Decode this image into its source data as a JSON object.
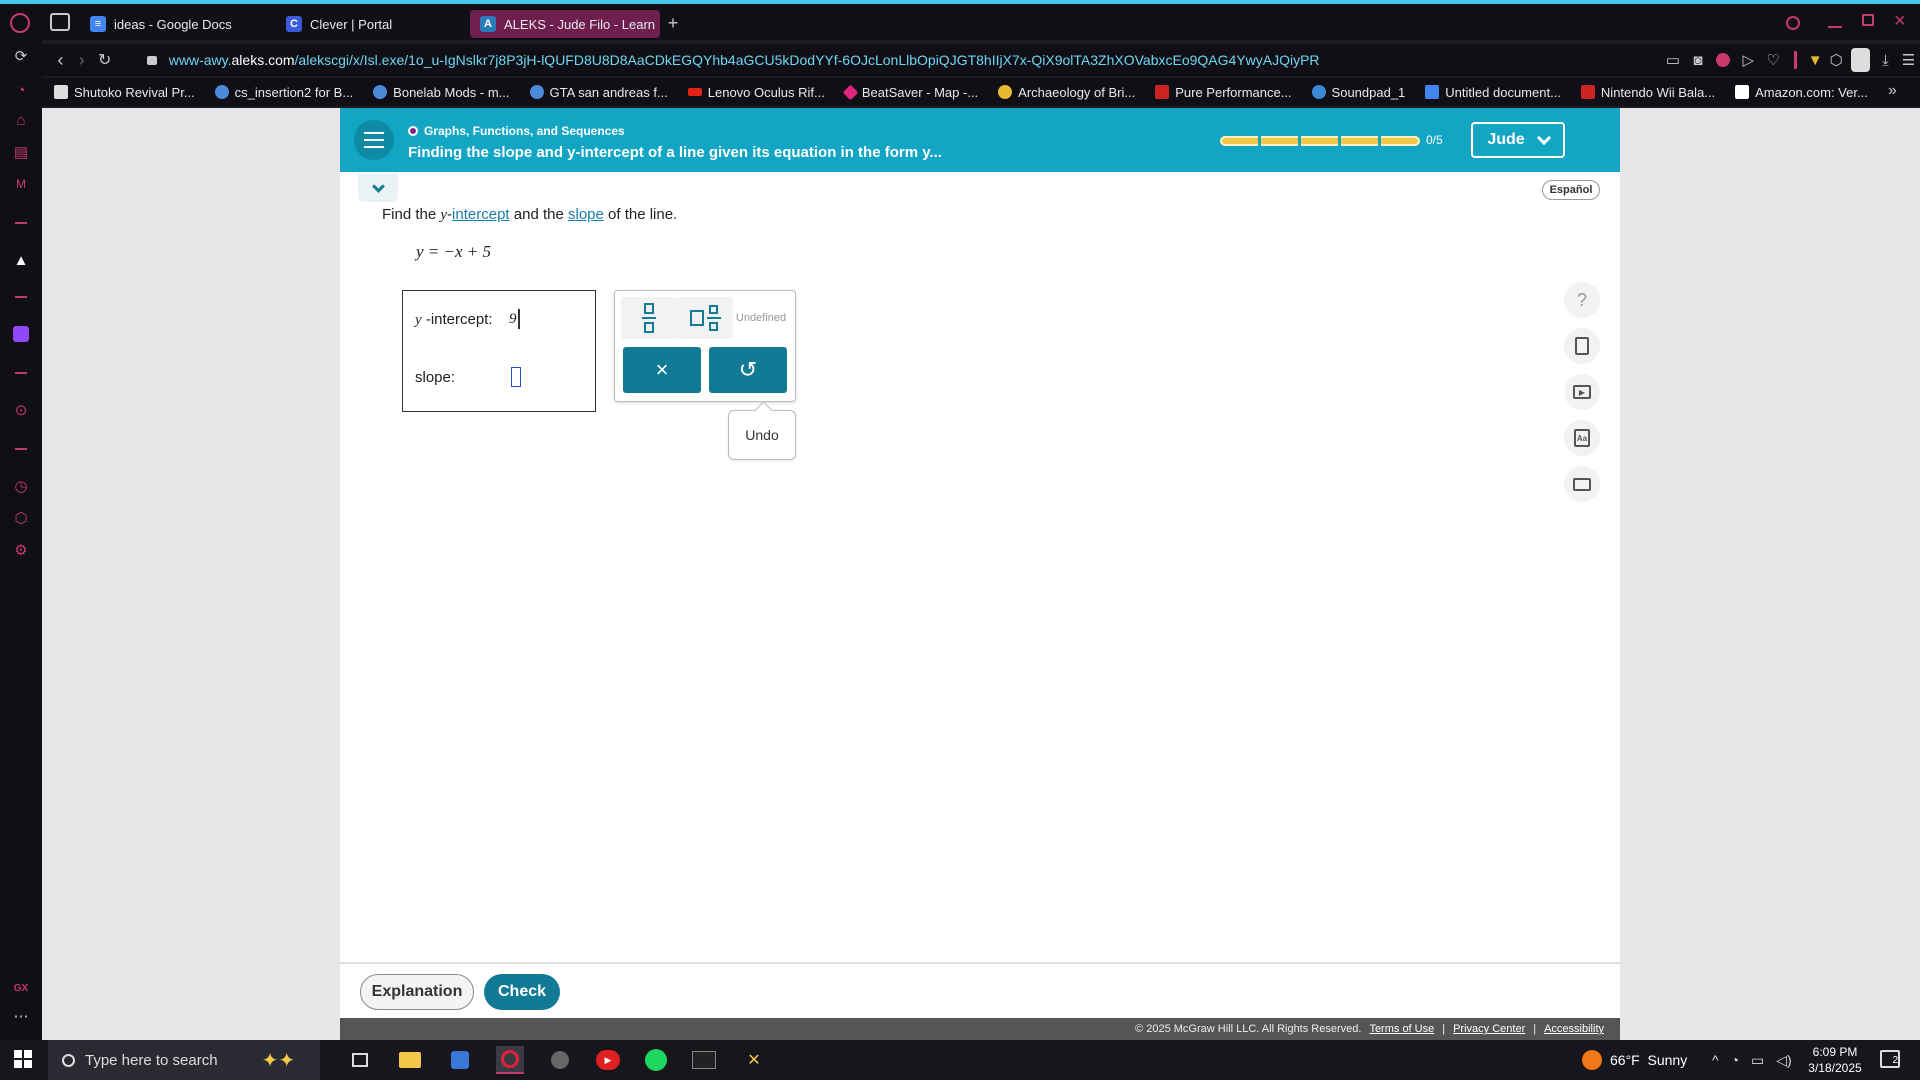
{
  "browser": {
    "tabs": [
      {
        "label": "ideas - Google Docs",
        "color": "#4285f4"
      },
      {
        "label": "Clever | Portal",
        "color": "#3b5bdb"
      },
      {
        "label": "ALEKS - Jude Filo - Learn",
        "color": "#2b7bb9"
      }
    ],
    "url_prefix": "www-awy.",
    "url_domain": "aleks.com",
    "url_path": "/alekscgi/x/Isl.exe/1o_u-IgNslkr7j8P3jH-lQUFD8U8D8AaCDkEGQYhb4aGCU5kDodYYf-6OJcLonLlbOpiQJGT8hIIjX7x-QiX9olTA3ZhXOVabxcEo9QAG4YwyAJQiyPR",
    "bookmarks": [
      {
        "label": "Shutoko Revival Pr...",
        "color": "#dddddd"
      },
      {
        "label": "cs_insertion2 for B...",
        "color": "#4a8ad8"
      },
      {
        "label": "Bonelab Mods - m...",
        "color": "#4a8ad8"
      },
      {
        "label": "GTA san andreas f...",
        "color": "#4a8ad8"
      },
      {
        "label": "Lenovo Oculus Rif...",
        "color": "#e2231a"
      },
      {
        "label": "BeatSaver - Map -...",
        "color": "#e02580"
      },
      {
        "label": "Archaeology of Bri...",
        "color": "#e8b830"
      },
      {
        "label": "Pure Performance...",
        "color": "#cc2222"
      },
      {
        "label": "Soundpad_1",
        "color": "#3a8ad8"
      },
      {
        "label": "Untitled document...",
        "color": "#4285f4"
      },
      {
        "label": "Nintendo Wii Bala...",
        "color": "#cc2222"
      },
      {
        "label": "Amazon.com: Ver...",
        "color": "#ffffff"
      }
    ]
  },
  "aleks": {
    "category": "Graphs, Functions, and Sequences",
    "topic": "Finding the slope and y-intercept of a line given its equation in the form y...",
    "progress_label": "0/5",
    "user": "Jude",
    "language": "Español",
    "prompt": {
      "pre": "Find the ",
      "var": "y",
      "dash": "-",
      "link1": "intercept",
      "mid": " and the ",
      "link2": "slope",
      "post": " of the line."
    },
    "equation": "y = −x + 5",
    "answer": {
      "yint_var": "y",
      "yint_label": "-intercept:",
      "yint_value": "9",
      "slope_label": "slope:"
    },
    "palette": {
      "undefined_label": "Undefined",
      "clear_symbol": "×",
      "undo_symbol": "↺",
      "undo_tooltip": "Undo"
    },
    "tools": [
      "help-icon",
      "calculator-icon",
      "video-icon",
      "dictionary-icon",
      "mail-icon"
    ],
    "tool_help_symbol": "?",
    "footer": {
      "explanation": "Explanation",
      "check": "Check",
      "copyright": "© 2025 McGraw Hill LLC. All Rights Reserved.",
      "terms": "Terms of Use",
      "privacy": "Privacy Center",
      "accessibility": "Accessibility",
      "sep": "|"
    }
  },
  "taskbar": {
    "search_placeholder": "Type here to search",
    "weather": "66°F  Sunny",
    "time": "6:09 PM",
    "date": "3/18/2025",
    "notif_count": "2"
  }
}
